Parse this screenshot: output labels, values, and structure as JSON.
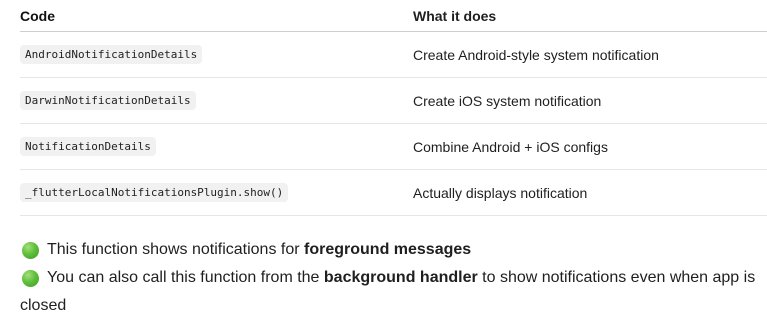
{
  "table": {
    "headers": {
      "code": "Code",
      "desc": "What it does"
    },
    "rows": [
      {
        "code": "AndroidNotificationDetails",
        "desc": "Create Android-style system notification"
      },
      {
        "code": "DarwinNotificationDetails",
        "desc": "Create iOS system notification"
      },
      {
        "code": "NotificationDetails",
        "desc": "Combine Android + iOS configs"
      },
      {
        "code": "_flutterLocalNotificationsPlugin.show()",
        "desc": "Actually displays notification"
      }
    ]
  },
  "bullets": {
    "icon": "green-circle-icon",
    "color": "#5fbf3c",
    "b1": {
      "pre": "This function shows notifications for ",
      "bold": "foreground messages"
    },
    "b2": {
      "pre": "You can also call this function from the ",
      "bold": "background handler",
      "post": " to show notifications even when app is",
      "cont": "closed"
    }
  }
}
